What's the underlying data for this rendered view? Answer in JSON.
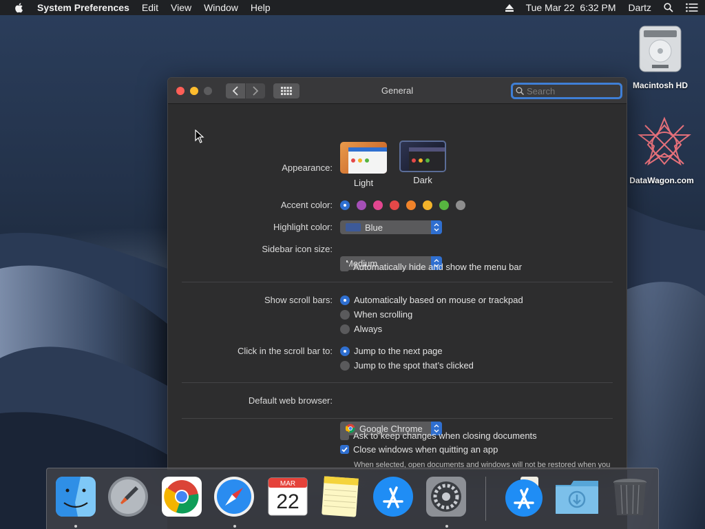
{
  "menubar": {
    "app_name": "System Preferences",
    "menus": [
      "Edit",
      "View",
      "Window",
      "Help"
    ],
    "datetime": "Tue Mar 22  6:32 PM",
    "user": "Dartz"
  },
  "desktop_icons": [
    {
      "label": "Macintosh HD",
      "icon": "hard-drive-icon"
    },
    {
      "label": "DataWagon.com",
      "icon": "datawagon-logo-icon"
    }
  ],
  "window": {
    "title": "General",
    "search_placeholder": "Search"
  },
  "general": {
    "appearance": {
      "label": "Appearance:",
      "options": [
        {
          "name": "Light",
          "selected": false
        },
        {
          "name": "Dark",
          "selected": true
        }
      ]
    },
    "accent_color": {
      "label": "Accent color:",
      "colors": [
        "#2f6fd0",
        "#a54fb7",
        "#e2468f",
        "#e54848",
        "#f0832a",
        "#f3b32a",
        "#57b540",
        "#8e8e8e"
      ],
      "selected_index": 0
    },
    "highlight_color": {
      "label": "Highlight color:",
      "value": "Blue",
      "swatch": "#3d5a99"
    },
    "sidebar_icon_size": {
      "label": "Sidebar icon size:",
      "value": "Medium"
    },
    "auto_hide_menu_bar": {
      "label": "Automatically hide and show the menu bar",
      "checked": false
    },
    "show_scroll_bars": {
      "label": "Show scroll bars:",
      "options": [
        {
          "label": "Automatically based on mouse or trackpad",
          "selected": true
        },
        {
          "label": "When scrolling",
          "selected": false
        },
        {
          "label": "Always",
          "selected": false
        }
      ]
    },
    "click_scroll_bar": {
      "label": "Click in the scroll bar to:",
      "options": [
        {
          "label": "Jump to the next page",
          "selected": true
        },
        {
          "label": "Jump to the spot that’s clicked",
          "selected": false
        }
      ]
    },
    "default_browser": {
      "label": "Default web browser:",
      "value": "Google Chrome"
    },
    "ask_keep_changes": {
      "label": "Ask to keep changes when closing documents",
      "checked": false
    },
    "close_windows": {
      "label": "Close windows when quitting an app",
      "checked": true
    },
    "close_windows_note": "When selected, open documents and windows will not be restored when you re-open an app."
  },
  "dock": {
    "items": [
      {
        "name": "Finder",
        "icon": "finder-icon",
        "running": true
      },
      {
        "name": "Launchpad",
        "icon": "launchpad-icon",
        "running": false
      },
      {
        "name": "Google Chrome",
        "icon": "chrome-icon",
        "running": false
      },
      {
        "name": "Safari",
        "icon": "safari-icon",
        "running": true
      },
      {
        "name": "Calendar",
        "icon": "calendar-icon",
        "running": false,
        "month": "MAR",
        "day": "22"
      },
      {
        "name": "Notes",
        "icon": "notes-icon",
        "running": false
      },
      {
        "name": "App Store",
        "icon": "app-store-icon",
        "running": false
      },
      {
        "name": "System Preferences",
        "icon": "system-preferences-icon",
        "running": true
      },
      {
        "name": "App Store Downloads",
        "icon": "app-store-icon",
        "running": false
      },
      {
        "name": "Downloads",
        "icon": "downloads-folder-icon",
        "running": false
      },
      {
        "name": "Trash",
        "icon": "trash-icon",
        "running": false
      }
    ]
  },
  "colors": {
    "accent_blue": "#2f6fd0",
    "window_bg": "#2d2d2e",
    "titlebar": "#38383a"
  }
}
